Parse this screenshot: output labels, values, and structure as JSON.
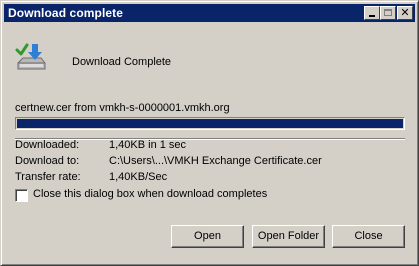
{
  "window": {
    "title": "Download complete",
    "controls": [
      "minimize",
      "maximize",
      "close"
    ]
  },
  "header": {
    "icon": "download-complete-icon",
    "text": "Download Complete"
  },
  "download": {
    "source": "certnew.cer from vmkh-s-0000001.vmkh.org",
    "progress_percent": 100
  },
  "details": {
    "downloaded_label": "Downloaded:",
    "downloaded_value": "1,40KB in 1 sec",
    "download_to_label": "Download to:",
    "download_to_value": "C:\\Users\\...\\VMKH Exchange Certificate.cer",
    "transfer_rate_label": "Transfer rate:",
    "transfer_rate_value": "1,40KB/Sec"
  },
  "options": {
    "close_on_complete_label": "Close this dialog box when download completes",
    "close_on_complete_checked": false
  },
  "buttons": {
    "open": "Open",
    "open_folder": "Open Folder",
    "close": "Close"
  },
  "colors": {
    "titlebar": "#0a246a",
    "progress": "#0a246a",
    "face": "#d4d0c8"
  }
}
